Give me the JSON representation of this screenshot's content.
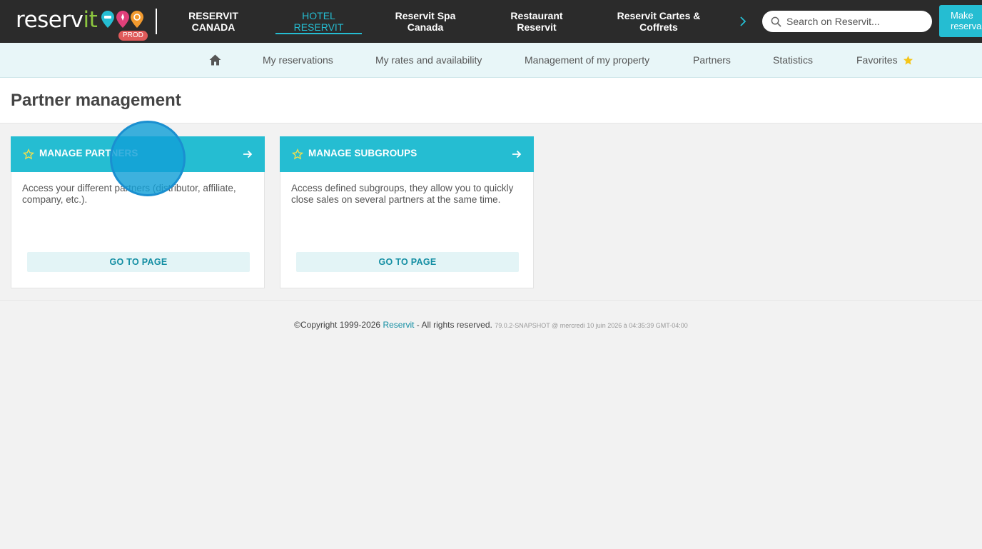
{
  "header": {
    "logo_text_main": "reserv",
    "logo_text_accent": "it",
    "env_badge": "PROD",
    "tabs": [
      {
        "label": "RESERVIT\nCANADA",
        "active": false
      },
      {
        "label": "HOTEL\nRESERVIT",
        "active": true
      },
      {
        "label": "Reservit Spa\nCanada",
        "active": false
      },
      {
        "label": "Restaurant\nReservit",
        "active": false
      },
      {
        "label": "Reservit Cartes &\nCoffrets",
        "active": false
      }
    ],
    "next_icon": "chevron-right-icon",
    "search_placeholder": "Search on Reservit...",
    "make_button": "Make\nreserva"
  },
  "subnav": {
    "home_icon": "home-icon",
    "items": [
      "My reservations",
      "My rates and availability",
      "Management of my property",
      "Partners",
      "Statistics",
      "Favorites"
    ]
  },
  "page": {
    "title": "Partner management"
  },
  "cards": [
    {
      "title": "MANAGE PARTNERS",
      "description": "Access your different partners (distributor, affiliate, company, etc.).",
      "button": "GO TO PAGE"
    },
    {
      "title": "MANAGE SUBGROUPS",
      "description": "Access defined subgroups, they allow you to quickly close sales on several partners at the same time.",
      "button": "GO TO PAGE"
    }
  ],
  "footer": {
    "copyright": "©Copyright 1999-2026",
    "brand": "Reservit",
    "rights": "- All rights reserved.",
    "version": "79.0.2-SNAPSHOT @ mercredi 10 juin 2026 à 04:35:39 GMT-04:00"
  },
  "colors": {
    "topbar": "#2b2b2b",
    "accent": "#25bdd2",
    "subnav_bg": "#e8f6f8",
    "star": "#f5c518",
    "page_bg": "#f2f2f2"
  }
}
